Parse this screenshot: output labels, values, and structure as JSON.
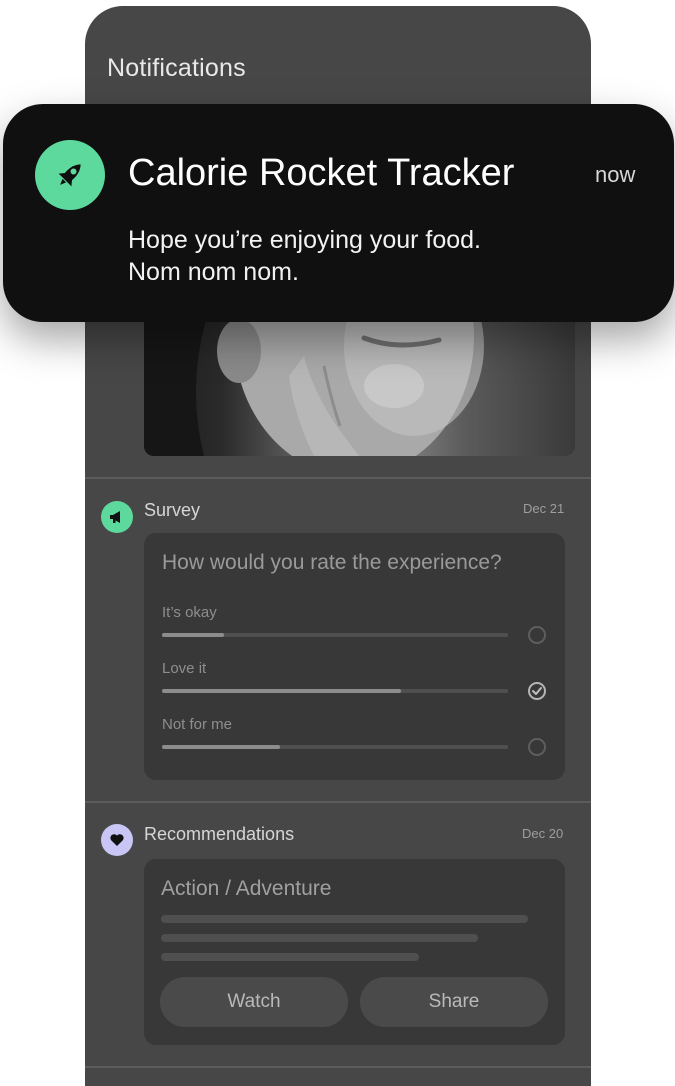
{
  "screen": {
    "title": "Notifications"
  },
  "banner": {
    "app_name": "Calorie Rocket Tracker",
    "time": "now",
    "message_lines": [
      "Hope you’re enjoying your food.",
      "Nom nom nom."
    ],
    "icon": "rocket-icon",
    "icon_color": "#5ed99d"
  },
  "survey": {
    "title": "Survey",
    "date": "Dec 21",
    "icon": "megaphone-icon",
    "icon_color": "#5ed99d",
    "question": "How would you rate the experience?",
    "options": [
      {
        "label": "It’s okay",
        "share": 0.18,
        "selected": false
      },
      {
        "label": "Love it",
        "share": 0.69,
        "selected": true
      },
      {
        "label": "Not for me",
        "share": 0.34,
        "selected": false
      }
    ]
  },
  "recommendations": {
    "title": "Recommendations",
    "date": "Dec 20",
    "icon": "heart-icon",
    "icon_color": "#c9c5f5",
    "genre": "Action / Adventure",
    "buttons": {
      "watch": "Watch",
      "share": "Share"
    }
  }
}
